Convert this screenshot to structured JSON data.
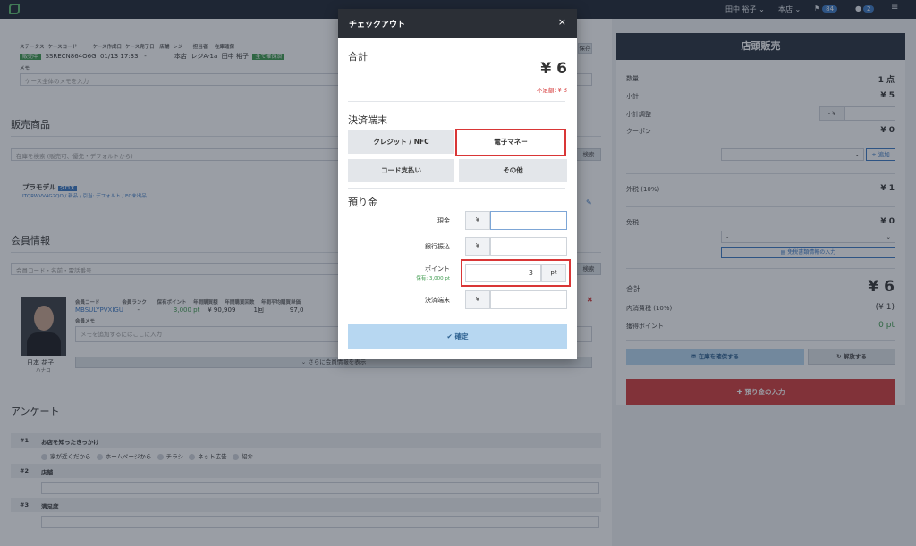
{
  "topbar": {
    "user": "田中 裕子",
    "store": "本店",
    "flag_count": "84",
    "chat_count": "2"
  },
  "case": {
    "headers": [
      "ステータス",
      "ケースコード",
      "ケース作成日",
      "ケース完了日",
      "店舗",
      "レジ",
      "担当者",
      "在庫確保"
    ],
    "status": "販売中",
    "code": "SSRECN864O6G",
    "created": "01/13 17:33",
    "completed": "-",
    "store": "本店",
    "register": "レジA-1a",
    "staff": "田中 裕子",
    "stock": "全て確保済",
    "memo_label": "メモ",
    "memo_placeholder": "ケース全体のメモを入力",
    "save_label": "保存"
  },
  "sales": {
    "title": "販売商品",
    "search_placeholder": "在庫を検索 (販売可、優先・デフォルトから)",
    "search_button": "検索",
    "item_name": "プラモデル",
    "item_tag": "グロス",
    "item_detail": "ITQRWVV4G2QO / 新品 / 引当: デフォルト / EC未出品"
  },
  "member": {
    "title": "会員情報",
    "search_placeholder": "会員コード・名前・電話番号",
    "search_button": "検索",
    "headers": [
      "会員コード",
      "会員ランク",
      "保有ポイント",
      "年間購買額",
      "年間購買回数",
      "年間平均購買単価"
    ],
    "code": "MBSULYPVXIGU",
    "rank": "-",
    "points": "3,000 pt",
    "annual_amount": "¥ 90,909",
    "annual_count": "1回",
    "avg": "97,0",
    "memo_label": "会員メモ",
    "memo_placeholder": "メモを追加するにはここに入力",
    "name": "日本 花子",
    "kana": "ハナコ",
    "more_button": "さらに会員情報を表示"
  },
  "survey": {
    "title": "アンケート",
    "q1_no": "#1",
    "q1": "お店を知ったきっかけ",
    "q1_options": [
      "家が近くだから",
      "ホームページから",
      "チラシ",
      "ネット広告",
      "紹介"
    ],
    "q2_no": "#2",
    "q2": "店舗",
    "q3_no": "#3",
    "q3": "満足度"
  },
  "register_panel": {
    "title": "店頭販売",
    "qty_label": "数量",
    "qty": "1 点",
    "subtotal_label": "小計",
    "subtotal": "¥ 5",
    "adjust_label": "小計調整",
    "adjust_prefix": "- ¥",
    "coupon_label": "クーポン",
    "coupon": "¥ 0",
    "coupon_sub": "-",
    "coupon_select": "-",
    "add_label": "追加",
    "tax_out_label": "外税 (10%)",
    "tax_out": "¥ 1",
    "tax_free_label": "免税",
    "tax_free": "¥ 0",
    "tax_free_select": "-",
    "tax_free_button": "免税書類情報の入力",
    "total_label": "合計",
    "total": "¥ 6",
    "inner_tax_label": "内消費税 (10%)",
    "inner_tax": "(¥ 1)",
    "earn_points_label": "獲得ポイント",
    "earn_points": "0 pt",
    "secure_button": "在庫を確保する",
    "release_button": "解放する",
    "deposit_button": "預り金の入力"
  },
  "modal": {
    "title": "チェックアウト",
    "close": "×",
    "total_heading": "合計",
    "total": "¥ 6",
    "shortage": "不足額: ¥ 3",
    "terminal_heading": "決済端末",
    "pay_methods": [
      "クレジット / NFC",
      "電子マネー",
      "コード支払い",
      "その他"
    ],
    "selected_method": "電子マネー",
    "deposit_heading": "預り金",
    "fields": {
      "cash": {
        "label": "現金",
        "prefix": "¥",
        "value": ""
      },
      "bank": {
        "label": "銀行振込",
        "prefix": "¥",
        "value": ""
      },
      "point": {
        "label": "ポイント",
        "sub": "保有: 3,000 pt",
        "value": "3",
        "suffix": "pt"
      },
      "terminal": {
        "label": "決済端末",
        "prefix": "¥",
        "value": ""
      }
    },
    "confirm": "確定"
  },
  "colors": {
    "accent_red": "#d93636",
    "confirm_blue": "#b7d7f1",
    "green": "#3d9a4d"
  }
}
